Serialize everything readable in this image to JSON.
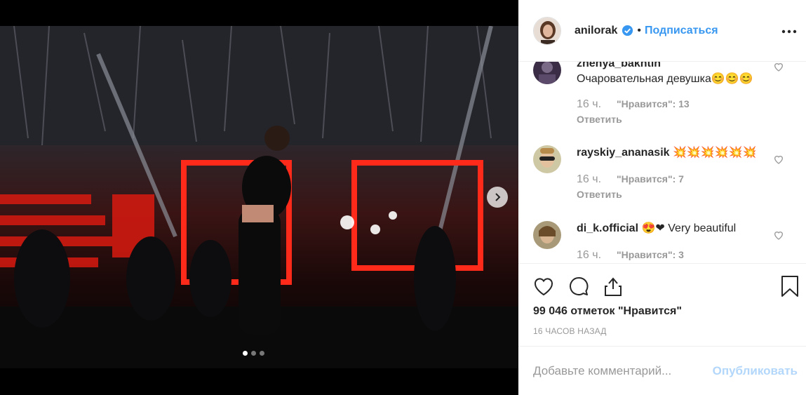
{
  "post": {
    "username": "anilorak",
    "bullet": "•",
    "follow_label": "Подписаться",
    "carousel": {
      "slides": 3,
      "active_slide": 1
    }
  },
  "comments": [
    {
      "username": "zhenya_bakhtin",
      "text": "Очаровательная девушка😊😊😊",
      "time": "16 ч.",
      "likes": "\"Нравится\": 13",
      "reply": "Ответить"
    },
    {
      "username": "rayskiy_ananasik",
      "text": "💥💥💥💥💥💥",
      "time": "16 ч.",
      "likes": "\"Нравится\": 7",
      "reply": "Ответить"
    },
    {
      "username": "di_k.official",
      "text": "😍❤ Very beautiful",
      "time": "16 ч.",
      "likes": "\"Нравится\": 3"
    }
  ],
  "actions": {
    "likes_count": "99 046 отметок \"Нравится\"",
    "time_ago": "16 ЧАСОВ НАЗАД"
  },
  "add_comment": {
    "placeholder": "Добавьте комментарий...",
    "publish_label": "Опубликовать"
  },
  "colors": {
    "accent": "#3897f0",
    "muted": "#999999",
    "text": "#262626",
    "publish_disabled": "#b3d7fb"
  },
  "icons": [
    "next-arrow-icon",
    "verified-icon",
    "more-options-icon",
    "heart-icon",
    "comment-icon",
    "share-icon",
    "bookmark-icon"
  ]
}
